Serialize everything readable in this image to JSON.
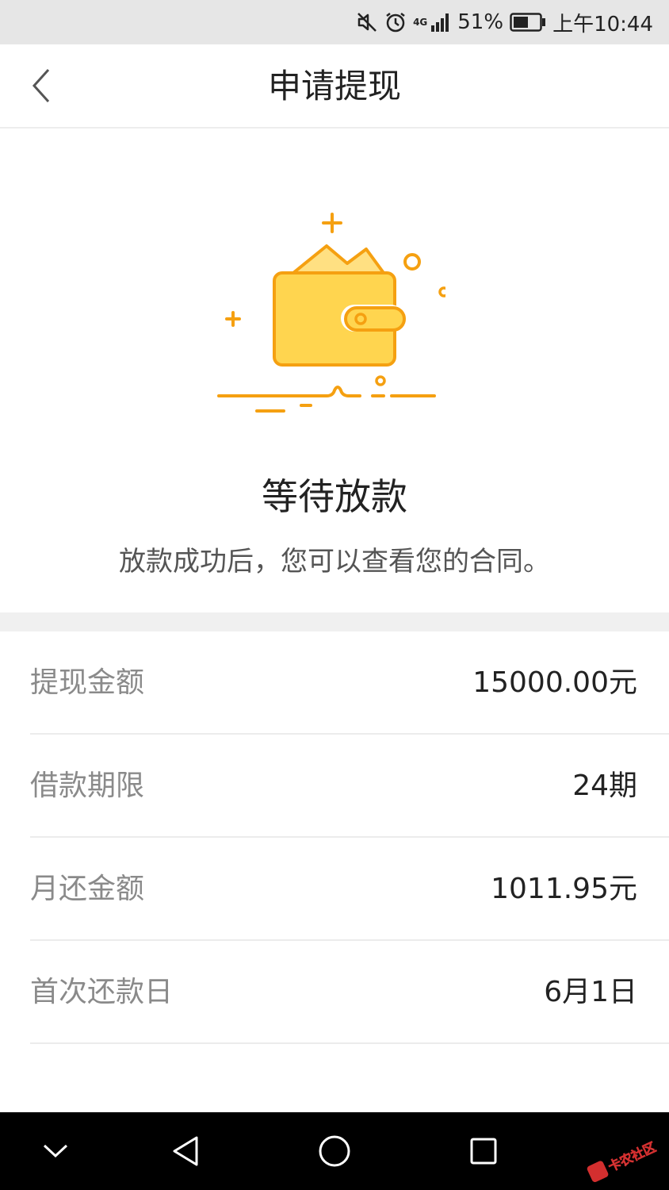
{
  "status_bar": {
    "network": "4G",
    "battery": "51%",
    "time": "上午10:44",
    "icons": [
      "mute-icon",
      "alarm-icon",
      "signal-icon",
      "battery-icon"
    ]
  },
  "nav": {
    "back_icon": "chevron-left-icon",
    "title": "申请提现"
  },
  "hero": {
    "illustration": "wallet-icon",
    "title": "等待放款",
    "subtitle": "放款成功后，您可以查看您的合同。"
  },
  "details": [
    {
      "label": "提现金额",
      "value": "15000.00元"
    },
    {
      "label": "借款期限",
      "value": "24期"
    },
    {
      "label": "月还金额",
      "value": "1011.95元"
    },
    {
      "label": "首次还款日",
      "value": "6月1日"
    }
  ],
  "system_nav": {
    "buttons": [
      "chevron-down-icon",
      "back-triangle-icon",
      "home-circle-icon",
      "recents-square-icon"
    ]
  },
  "watermark": {
    "text": "卡农社区"
  },
  "colors": {
    "accent": "#f5a623",
    "wallet_fill": "#ffd54f",
    "wallet_stroke": "#f5a011",
    "label": "#8a8a8a",
    "value": "#222222",
    "divider": "#ececec",
    "section_bg": "#f0f0f0"
  }
}
